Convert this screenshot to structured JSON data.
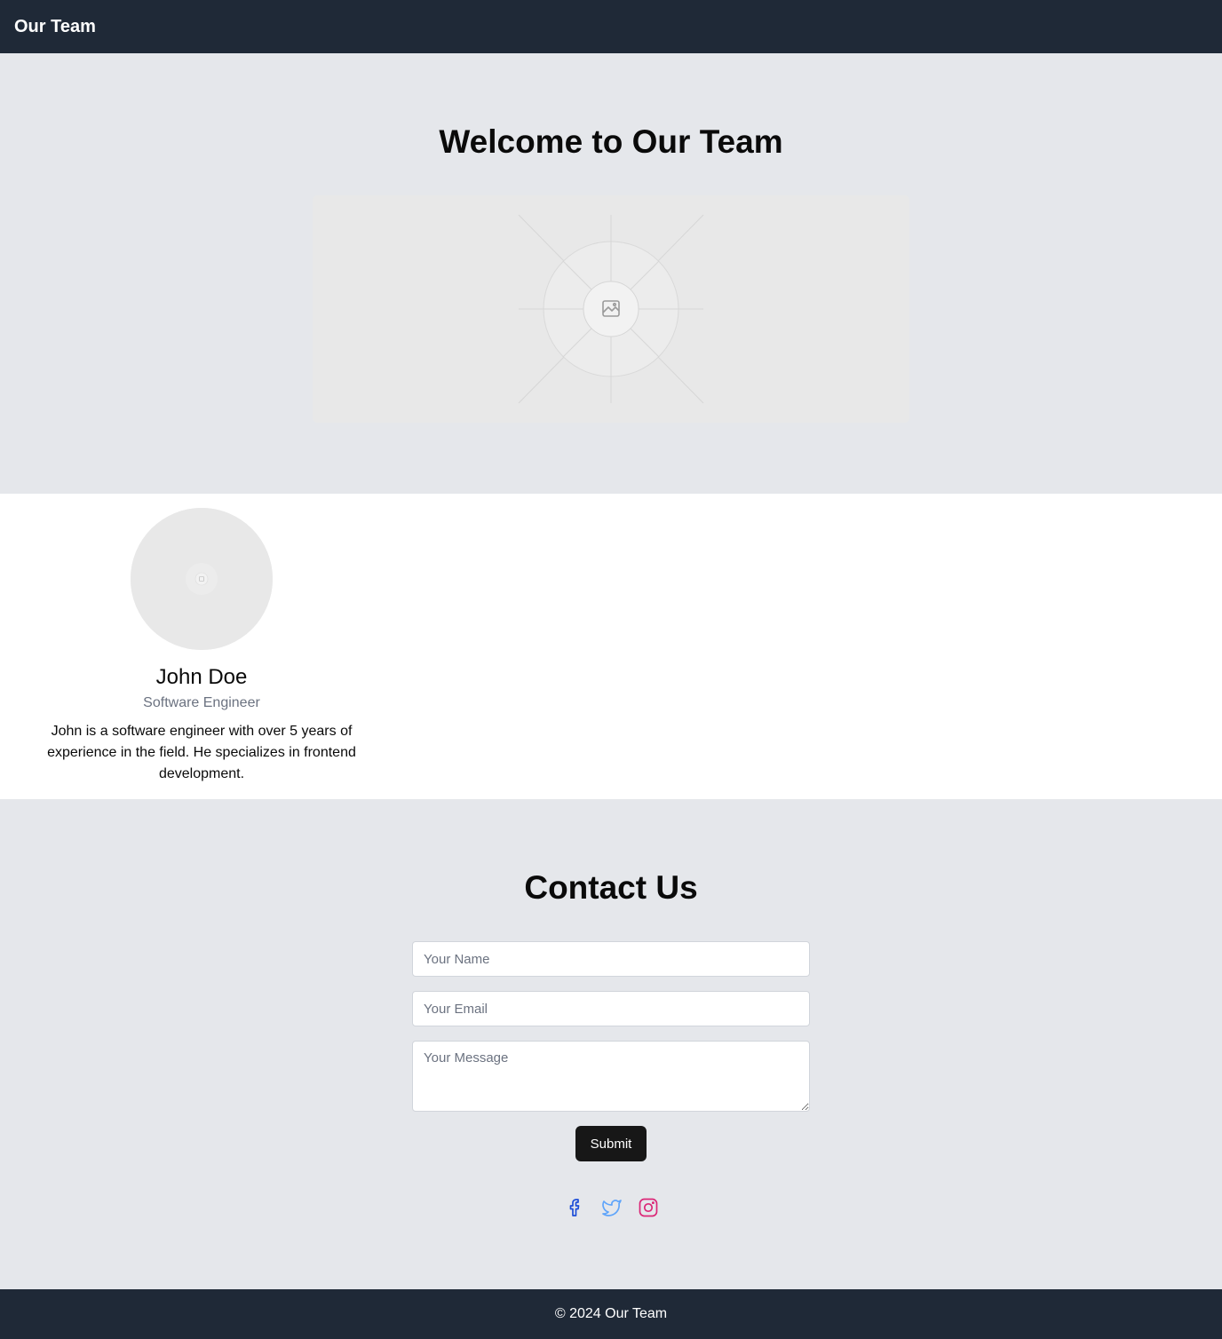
{
  "header": {
    "brand": "Our Team"
  },
  "hero": {
    "title": "Welcome to Our Team",
    "image_icon": "image-placeholder-icon"
  },
  "team": {
    "members": [
      {
        "name": "John Doe",
        "role": "Software Engineer",
        "bio": "John is a software engineer with over 5 years of experience in the field. He specializes in frontend development.",
        "avatar_icon": "image-placeholder-icon"
      }
    ]
  },
  "contact": {
    "title": "Contact Us",
    "name_placeholder": "Your Name",
    "email_placeholder": "Your Email",
    "message_placeholder": "Your Message",
    "submit_label": "Submit",
    "socials": [
      {
        "icon": "facebook-icon",
        "color": "#1d4ed8"
      },
      {
        "icon": "twitter-icon",
        "color": "#60a5fa"
      },
      {
        "icon": "instagram-icon",
        "color": "#db2777"
      }
    ]
  },
  "footer": {
    "text": "© 2024 Our Team"
  }
}
